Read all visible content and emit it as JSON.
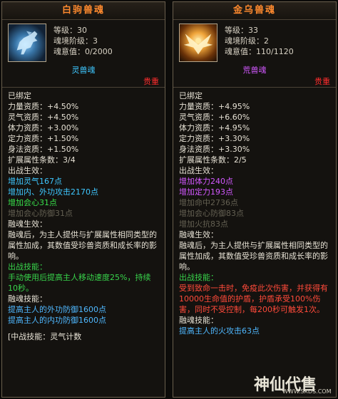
{
  "left": {
    "title": "白驹兽魂",
    "stats": [
      "等级：30",
      "魂境阶级：3",
      "魂意值：0/2000"
    ],
    "soul_type": "灵兽魂",
    "rarity": "贵重",
    "bound": "已绑定",
    "aptitudes": [
      "力量资质：+4.50%",
      "灵气资质：+4.50%",
      "体力资质：+3.00%",
      "定力资质：+1.50%",
      "身法资质：+1.50%"
    ],
    "ext_count": "扩展属性条数：3/4",
    "battle_title": "出战生效：",
    "battle_active": [
      "增加灵气167点",
      "增加内、外功攻击2170点",
      "增加会心31点"
    ],
    "battle_inactive": [
      "增加会心防御31点"
    ],
    "fusion_title": "融魂生效：",
    "fusion_desc": "融魂后，为主人提供与扩展属性相同类型的属性加成，其数值受珍兽资质和成长率的影响。",
    "skill_title": "出战技能：",
    "skill_desc": "手动使用后提高主人移动速度25%，持续10秒。",
    "fusion_skill_title": "融魂技能：",
    "fusion_skills": [
      "提高主人的外功防御1600点",
      "提高主人的内功防御1600点"
    ],
    "footer_partial": "[中战技能：灵气计数"
  },
  "right": {
    "title": "金乌兽魂",
    "stats": [
      "等级：33",
      "魂境阶级：2",
      "魂意值：110/1120"
    ],
    "soul_type": "荒兽魂",
    "rarity": "贵重",
    "bound": "已绑定",
    "aptitudes": [
      "力量资质：+4.95%",
      "灵气资质：+6.60%",
      "体力资质：+4.95%",
      "定力资质：+3.30%",
      "身法资质：+3.30%"
    ],
    "ext_count": "扩展属性条数：2/5",
    "battle_title": "出战生效：",
    "battle_active": [
      "增加体力240点",
      "增加定力193点"
    ],
    "battle_inactive": [
      "增加命中2736点",
      "增加会心防御83点",
      "增加火抗83点"
    ],
    "fusion_title": "融魂生效：",
    "fusion_desc": "融魂后，为主人提供与扩展属性相同类型的属性加成，其数值受珍兽资质和成长率的影响。",
    "skill_title": "出战技能：",
    "skill_desc": "受到致命一击时，免疫此次伤害，并获得有10000生命值的护盾，护盾承受100%伤害，同时不受控制，每200秒可触发1次。",
    "fusion_skill_title": "融魂技能：",
    "fusion_skills": [
      "提高主人的火攻击63点"
    ]
  },
  "watermark": {
    "logo": "神仙代售",
    "url": "WWW.SXDS.COM"
  },
  "colors": {
    "title": "#ff8a2e",
    "lingshou": "#3ec7ff",
    "huangshou": "#d258ff",
    "rarity": "#ff2d2d",
    "active_green": "#38e04b",
    "inactive_gray": "#646052"
  }
}
